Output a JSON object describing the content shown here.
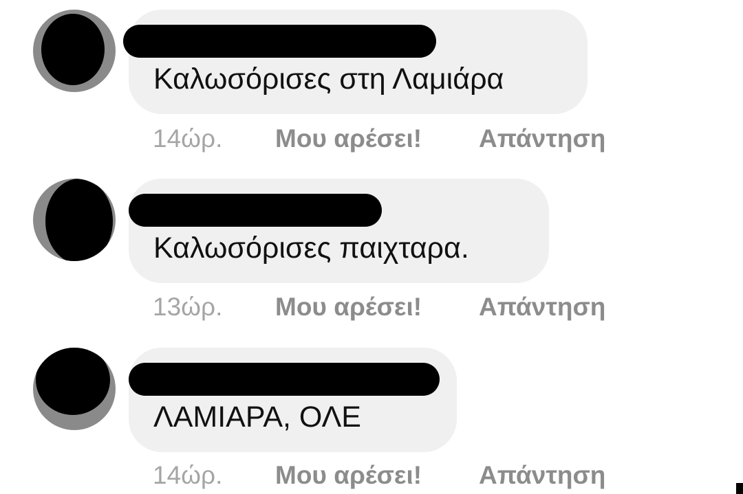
{
  "comments": [
    {
      "text": "Καλωσόρισες στη Λαμιάρα",
      "time": "14ώρ.",
      "like_label": "Μου αρέσει!",
      "reply_label": "Απάντηση"
    },
    {
      "text": "Καλωσόρισες παιχταρα.",
      "time": "13ώρ.",
      "like_label": "Μου αρέσει!",
      "reply_label": "Απάντηση"
    },
    {
      "text": "ΛΑΜΙΑΡΑ, ΟΛΕ",
      "time": "14ώρ.",
      "like_label": "Μου αρέσει!",
      "reply_label": "Απάντηση"
    }
  ],
  "colors": {
    "bubble": "#f0f0f0",
    "meta_text": "#8c8c8c",
    "timestamp": "#a5a5a5",
    "redaction": "#000000"
  }
}
